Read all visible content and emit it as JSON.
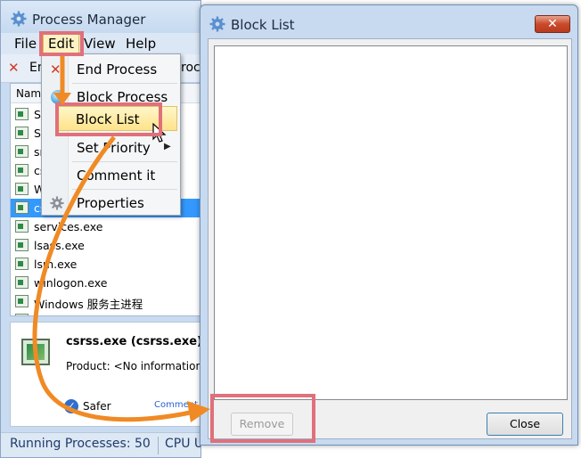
{
  "process_manager": {
    "title": "Process Manager",
    "menu": [
      "File",
      "Edit",
      "View",
      "Help"
    ],
    "toolbar": {
      "end_label": "En",
      "other_label": "roc"
    },
    "list_header": "Name",
    "rows": [
      {
        "text": "Sy",
        "icon": "system-icon",
        "selected": false
      },
      {
        "text": "Sy",
        "icon": "system-icon",
        "selected": false
      },
      {
        "text": "sm",
        "icon": "process-icon",
        "selected": false
      },
      {
        "text": "cs",
        "icon": "process-icon",
        "selected": false
      },
      {
        "text": "W",
        "icon": "process-icon",
        "selected": false
      },
      {
        "text": "cs",
        "icon": "process-icon",
        "selected": true
      },
      {
        "text": "services.exe",
        "icon": "process-icon",
        "selected": false
      },
      {
        "text": "lsass.exe",
        "icon": "process-icon",
        "selected": false
      },
      {
        "text": "lsm.exe",
        "icon": "process-icon",
        "selected": false
      },
      {
        "text": "winlogon.exe",
        "icon": "process-icon",
        "selected": false
      },
      {
        "text": "Windows 服务主进程",
        "icon": "process-icon",
        "selected": false
      },
      {
        "text": "Windows 服务主进程",
        "icon": "process-icon",
        "selected": false
      }
    ],
    "details": {
      "name": "csrss.exe (csrss.exe)",
      "product_label": "Product:",
      "product_value": "<No information>",
      "safety": "Safer",
      "comment_link": "Comment it"
    },
    "status": {
      "running": "Running Processes: 50",
      "cpu": "CPU U"
    }
  },
  "edit_menu": {
    "items": [
      {
        "label": "End Process",
        "icon": "x-icon"
      },
      {
        "label": "Block Process",
        "icon": "globe-icon"
      },
      {
        "label": "Block List",
        "highlighted": true
      },
      {
        "label": "Set Priority",
        "has_submenu": true
      },
      {
        "label": "Comment it"
      },
      {
        "label": "Properties",
        "icon": "gear-icon"
      }
    ]
  },
  "block_list": {
    "title": "Block List",
    "close_glyph": "✕",
    "remove_label": "Remove",
    "close_label": "Close"
  },
  "colors": {
    "accent": "#f08a24",
    "highlight_box": "#e0707b",
    "selection": "#3399ff"
  }
}
